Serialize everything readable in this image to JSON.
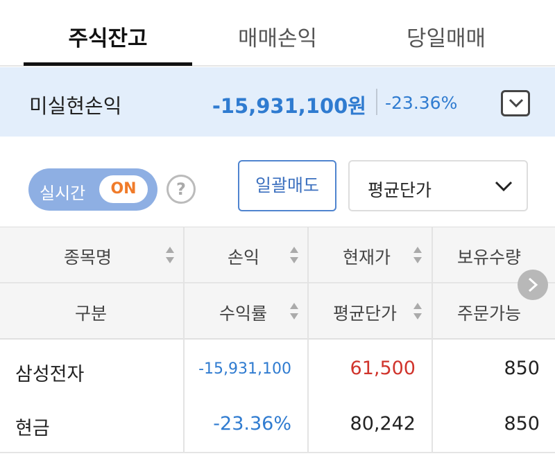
{
  "tabs": [
    {
      "label": "주식잔고",
      "active": true
    },
    {
      "label": "매매손익",
      "active": false
    },
    {
      "label": "당일매매",
      "active": false
    }
  ],
  "summary": {
    "label": "미실현손익",
    "amount": "-15,931,100원",
    "rate": "-23.36%"
  },
  "controls": {
    "realtime_label": "실시간",
    "realtime_state": "ON",
    "help_glyph": "?",
    "sell_all_label": "일괄매도",
    "price_mode_selected": "평균단가"
  },
  "table": {
    "header_row1": [
      "종목명",
      "손익",
      "현재가",
      "보유수량"
    ],
    "header_row2": [
      "구분",
      "수익률",
      "평균단가",
      "주문가능"
    ],
    "rows": [
      {
        "name": "삼성전자",
        "profit": "-15,931,100",
        "current_price": "61,500",
        "quantity": "850"
      },
      {
        "name": "현금",
        "profit_rate": "-23.36%",
        "avg_price": "80,242",
        "orderable": "850"
      }
    ]
  },
  "colors": {
    "accent_blue": "#2f7bd0",
    "price_red": "#d0342c",
    "on_orange": "#f07b2a",
    "summary_bg": "#e3eefb"
  }
}
